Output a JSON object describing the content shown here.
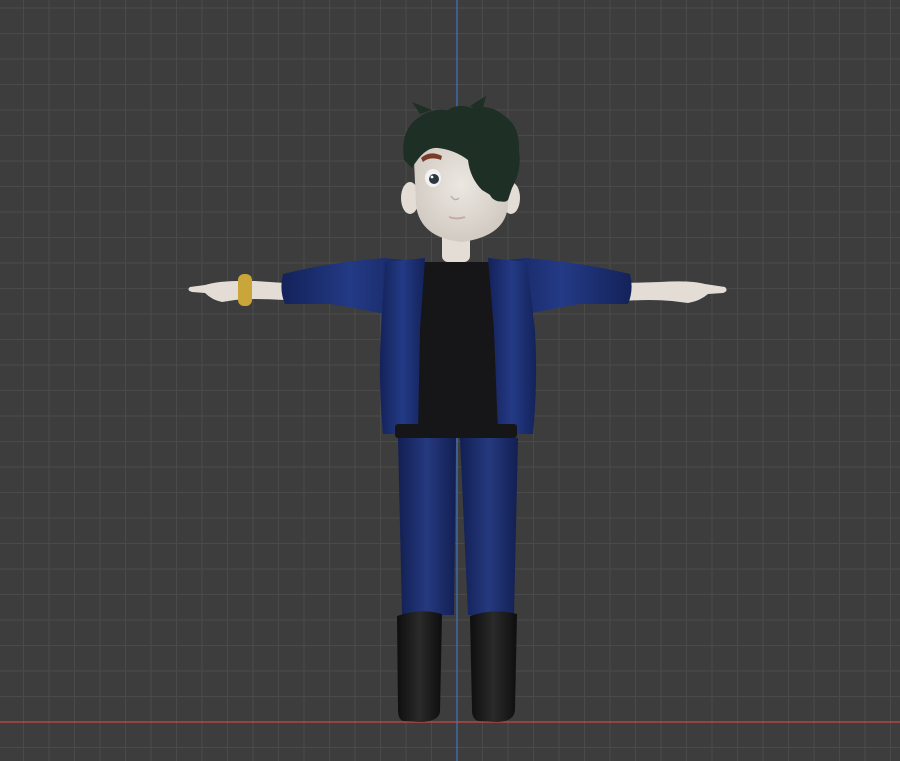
{
  "viewport": {
    "background_color": "#3d3d3d",
    "grid_color": "#4a4a4a",
    "grid_major_color": "#515151",
    "z_axis_color": "#3f74c4",
    "x_axis_color": "#c64a4a"
  },
  "character": {
    "skin_color": "#e3ddd6",
    "hair_color": "#1e2f26",
    "jacket_color": "#1b2c6a",
    "shirt_color": "#161618",
    "pants_color": "#1a2a68",
    "boots_color": "#141414",
    "bracelet_color": "#c9a53a",
    "eyebrow_color": "#7a3a2a"
  }
}
